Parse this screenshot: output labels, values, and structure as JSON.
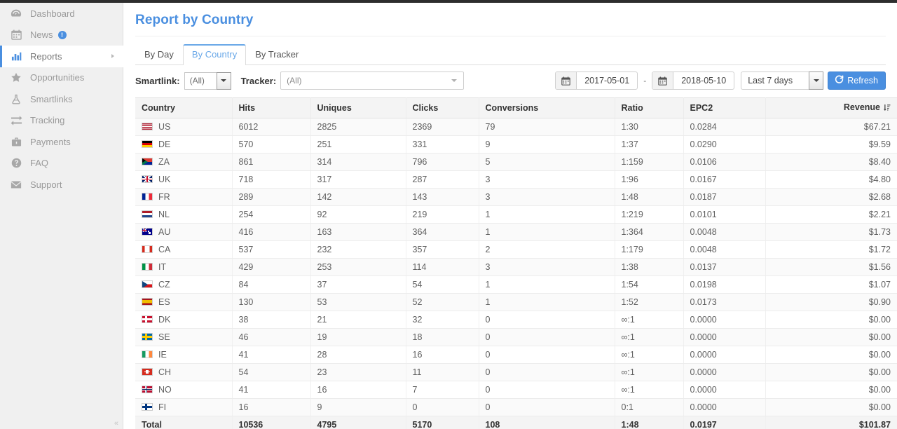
{
  "sidebar": {
    "items": [
      {
        "label": "Dashboard",
        "icon": "dashboard-icon",
        "active": false,
        "badge": null,
        "caret": false
      },
      {
        "label": "News",
        "icon": "calendar-icon",
        "active": false,
        "badge": "!",
        "caret": false
      },
      {
        "label": "Reports",
        "icon": "bar-chart-icon",
        "active": true,
        "badge": null,
        "caret": true
      },
      {
        "label": "Opportunities",
        "icon": "star-icon",
        "active": false,
        "badge": null,
        "caret": false
      },
      {
        "label": "Smartlinks",
        "icon": "flask-icon",
        "active": false,
        "badge": null,
        "caret": false
      },
      {
        "label": "Tracking",
        "icon": "exchange-icon",
        "active": false,
        "badge": null,
        "caret": false
      },
      {
        "label": "Payments",
        "icon": "briefcase-icon",
        "active": false,
        "badge": null,
        "caret": false
      },
      {
        "label": "FAQ",
        "icon": "question-circle-icon",
        "active": false,
        "badge": null,
        "caret": false
      },
      {
        "label": "Support",
        "icon": "envelope-icon",
        "active": false,
        "badge": null,
        "caret": false
      }
    ],
    "collapse_label": "«"
  },
  "page": {
    "title": "Report by Country",
    "accent_color": "#4a8fe0"
  },
  "tabs": [
    {
      "label": "By Day",
      "active": false
    },
    {
      "label": "By Country",
      "active": true
    },
    {
      "label": "By Tracker",
      "active": false
    }
  ],
  "filters": {
    "smartlink_label": "Smartlink:",
    "smartlink_value": "(All)",
    "tracker_label": "Tracker:",
    "tracker_value": "(All)",
    "date_from": "2017-05-01",
    "date_to": "2018-05-10",
    "date_separator": "-",
    "preset_value": "Last 7 days",
    "refresh_label": "Refresh"
  },
  "table": {
    "columns": [
      "Country",
      "Hits",
      "Uniques",
      "Clicks",
      "Conversions",
      "Ratio",
      "EPC2",
      "Revenue"
    ],
    "sorted_column": "Revenue",
    "sort_direction": "desc",
    "rows": [
      {
        "country": "US",
        "flag": "flag-us",
        "hits": "6012",
        "uniques": "2825",
        "clicks": "2369",
        "conversions": "79",
        "ratio": "1:30",
        "epc2": "0.0284",
        "revenue": "$67.21"
      },
      {
        "country": "DE",
        "flag": "flag-de",
        "hits": "570",
        "uniques": "251",
        "clicks": "331",
        "conversions": "9",
        "ratio": "1:37",
        "epc2": "0.0290",
        "revenue": "$9.59"
      },
      {
        "country": "ZA",
        "flag": "flag-za",
        "hits": "861",
        "uniques": "314",
        "clicks": "796",
        "conversions": "5",
        "ratio": "1:159",
        "epc2": "0.0106",
        "revenue": "$8.40"
      },
      {
        "country": "UK",
        "flag": "flag-uk",
        "hits": "718",
        "uniques": "317",
        "clicks": "287",
        "conversions": "3",
        "ratio": "1:96",
        "epc2": "0.0167",
        "revenue": "$4.80"
      },
      {
        "country": "FR",
        "flag": "flag-fr",
        "hits": "289",
        "uniques": "142",
        "clicks": "143",
        "conversions": "3",
        "ratio": "1:48",
        "epc2": "0.0187",
        "revenue": "$2.68"
      },
      {
        "country": "NL",
        "flag": "flag-nl",
        "hits": "254",
        "uniques": "92",
        "clicks": "219",
        "conversions": "1",
        "ratio": "1:219",
        "epc2": "0.0101",
        "revenue": "$2.21"
      },
      {
        "country": "AU",
        "flag": "flag-au",
        "hits": "416",
        "uniques": "163",
        "clicks": "364",
        "conversions": "1",
        "ratio": "1:364",
        "epc2": "0.0048",
        "revenue": "$1.73"
      },
      {
        "country": "CA",
        "flag": "flag-ca",
        "hits": "537",
        "uniques": "232",
        "clicks": "357",
        "conversions": "2",
        "ratio": "1:179",
        "epc2": "0.0048",
        "revenue": "$1.72"
      },
      {
        "country": "IT",
        "flag": "flag-it",
        "hits": "429",
        "uniques": "253",
        "clicks": "114",
        "conversions": "3",
        "ratio": "1:38",
        "epc2": "0.0137",
        "revenue": "$1.56"
      },
      {
        "country": "CZ",
        "flag": "flag-cz",
        "hits": "84",
        "uniques": "37",
        "clicks": "54",
        "conversions": "1",
        "ratio": "1:54",
        "epc2": "0.0198",
        "revenue": "$1.07"
      },
      {
        "country": "ES",
        "flag": "flag-es",
        "hits": "130",
        "uniques": "53",
        "clicks": "52",
        "conversions": "1",
        "ratio": "1:52",
        "epc2": "0.0173",
        "revenue": "$0.90"
      },
      {
        "country": "DK",
        "flag": "flag-dk",
        "hits": "38",
        "uniques": "21",
        "clicks": "32",
        "conversions": "0",
        "ratio": "∞:1",
        "epc2": "0.0000",
        "revenue": "$0.00"
      },
      {
        "country": "SE",
        "flag": "flag-se",
        "hits": "46",
        "uniques": "19",
        "clicks": "18",
        "conversions": "0",
        "ratio": "∞:1",
        "epc2": "0.0000",
        "revenue": "$0.00"
      },
      {
        "country": "IE",
        "flag": "flag-ie",
        "hits": "41",
        "uniques": "28",
        "clicks": "16",
        "conversions": "0",
        "ratio": "∞:1",
        "epc2": "0.0000",
        "revenue": "$0.00"
      },
      {
        "country": "CH",
        "flag": "flag-ch",
        "hits": "54",
        "uniques": "23",
        "clicks": "11",
        "conversions": "0",
        "ratio": "∞:1",
        "epc2": "0.0000",
        "revenue": "$0.00"
      },
      {
        "country": "NO",
        "flag": "flag-no",
        "hits": "41",
        "uniques": "16",
        "clicks": "7",
        "conversions": "0",
        "ratio": "∞:1",
        "epc2": "0.0000",
        "revenue": "$0.00"
      },
      {
        "country": "FI",
        "flag": "flag-fi",
        "hits": "16",
        "uniques": "9",
        "clicks": "0",
        "conversions": "0",
        "ratio": "0:1",
        "epc2": "0.0000",
        "revenue": "$0.00"
      }
    ],
    "total": {
      "country": "Total",
      "hits": "10536",
      "uniques": "4795",
      "clicks": "5170",
      "conversions": "108",
      "ratio": "1:48",
      "epc2": "0.0197",
      "revenue": "$101.87"
    }
  }
}
